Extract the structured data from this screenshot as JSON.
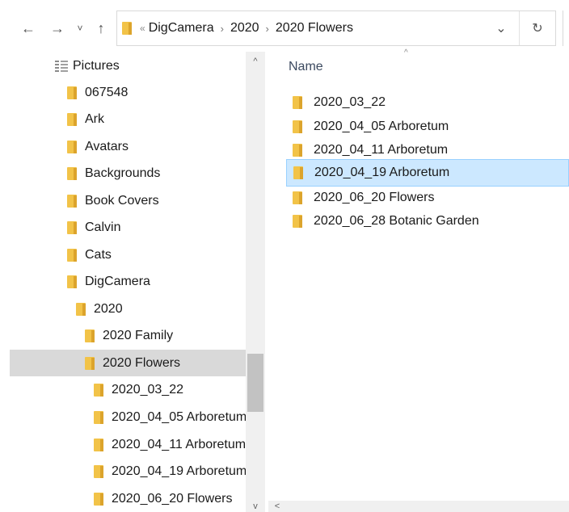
{
  "toolbar": {
    "back_glyph": "←",
    "forward_glyph": "→",
    "recent_glyph": "˅",
    "up_glyph": "↑"
  },
  "address_bar": {
    "overflow_glyph": "«",
    "breadcrumbs": [
      "DigCamera",
      "2020",
      "2020 Flowers"
    ],
    "separator": "›",
    "dropdown_glyph": "⌄",
    "refresh_glyph": "↻"
  },
  "nav_pane": {
    "items": [
      {
        "label": "Pictures",
        "icon": "pictures-library-icon"
      },
      {
        "label": "067548",
        "icon": "folder-icon"
      },
      {
        "label": "Ark",
        "icon": "folder-icon"
      },
      {
        "label": "Avatars",
        "icon": "folder-icon"
      },
      {
        "label": "Backgrounds",
        "icon": "folder-icon"
      },
      {
        "label": "Book Covers",
        "icon": "folder-icon"
      },
      {
        "label": "Calvin",
        "icon": "folder-icon"
      },
      {
        "label": "Cats",
        "icon": "folder-icon"
      },
      {
        "label": "DigCamera",
        "icon": "folder-icon"
      },
      {
        "label": "2020",
        "icon": "folder-icon"
      },
      {
        "label": "2020 Family",
        "icon": "folder-icon"
      },
      {
        "label": "2020 Flowers",
        "icon": "folder-icon",
        "selected": true
      },
      {
        "label": "2020_03_22",
        "icon": "folder-icon"
      },
      {
        "label": "2020_04_05 Arboretum",
        "icon": "folder-icon"
      },
      {
        "label": "2020_04_11 Arboretum",
        "icon": "folder-icon"
      },
      {
        "label": "2020_04_19 Arboretum",
        "icon": "folder-icon"
      },
      {
        "label": "2020_06_20 Flowers",
        "icon": "folder-icon"
      }
    ],
    "scroll_up_glyph": "^",
    "scroll_down_glyph": "v"
  },
  "content": {
    "column_name": "Name",
    "sort_glyph": "^",
    "files": [
      {
        "label": "2020_03_22"
      },
      {
        "label": "2020_04_05 Arboretum"
      },
      {
        "label": "2020_04_11 Arboretum"
      },
      {
        "label": "2020_04_19 Arboretum",
        "selected": true
      },
      {
        "label": "2020_06_20 Flowers"
      },
      {
        "label": "2020_06_28 Botanic Garden"
      }
    ],
    "scroll_left_glyph": "<"
  },
  "colors": {
    "folder": "#f2c348",
    "selection_bg": "#cce8ff",
    "selection_border": "#99d1ff",
    "nav_selected": "#d9d9d9"
  }
}
